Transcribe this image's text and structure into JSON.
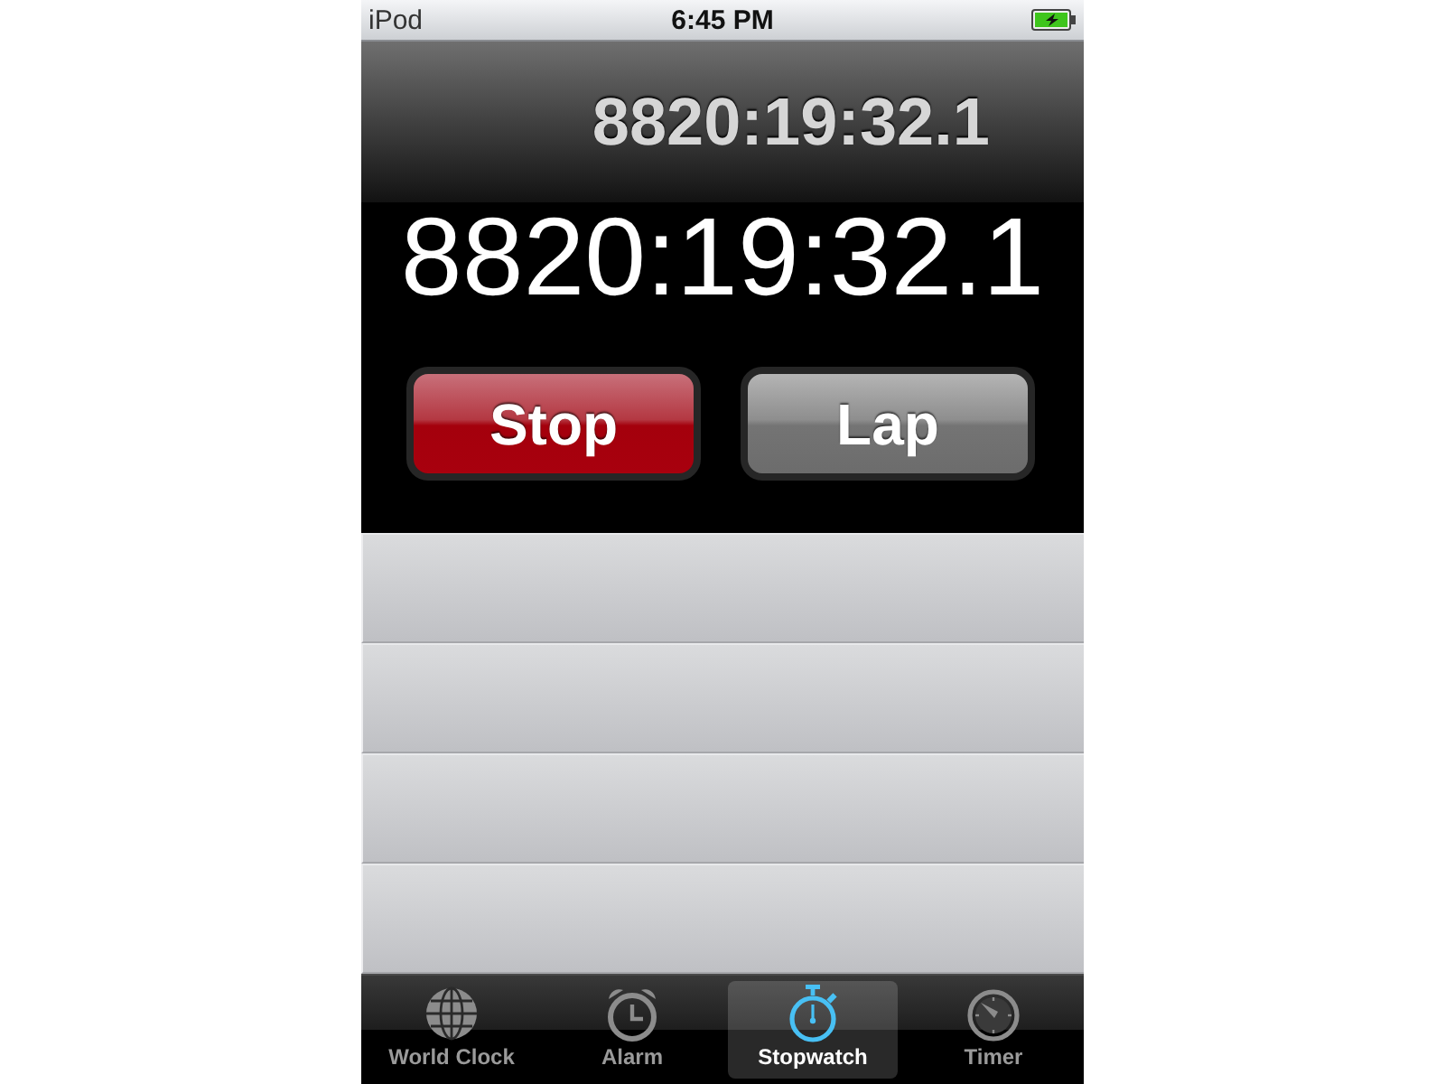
{
  "status_bar": {
    "carrier": "iPod",
    "time": "6:45 PM",
    "charging": true
  },
  "header": {
    "lap_time": "8820:19:32.1"
  },
  "main_time": "8820:19:32.1",
  "buttons": [
    {
      "label": "Stop",
      "kind": "stop"
    },
    {
      "label": "Lap",
      "kind": "lap"
    }
  ],
  "tabs": [
    {
      "label": "World Clock",
      "selected": false
    },
    {
      "label": "Alarm",
      "selected": false
    },
    {
      "label": "Stopwatch",
      "selected": true
    },
    {
      "label": "Timer",
      "selected": false
    }
  ]
}
